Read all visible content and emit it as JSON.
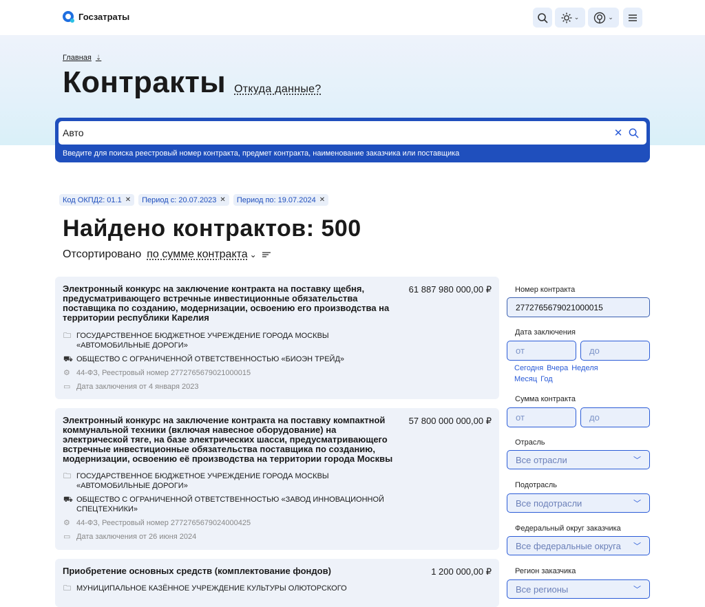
{
  "app": {
    "name": "Госзатраты"
  },
  "breadcrumb": {
    "home": "Главная"
  },
  "page": {
    "title": "Контракты",
    "source_link": "Откуда данные?"
  },
  "search": {
    "value": "Авто",
    "hint": "Введите для поиска реестровый номер контракта, предмет контракта, наименование заказчика или поставщика"
  },
  "filters_chips": [
    {
      "label": "Код ОКПД2: 01.1"
    },
    {
      "label": "Период с: 20.07.2023"
    },
    {
      "label": "Период по: 19.07.2024"
    }
  ],
  "results": {
    "found_label": "Найдено контрактов: 500",
    "sort_prefix": "Отсортировано",
    "sort_value": "по сумме контракта"
  },
  "contracts": [
    {
      "title": "Электронный конкурс на заключение контракта на поставку щебня, предусматривающего встречные инвестиционные обязательства поставщика по созданию, модернизации, освоению его производства на территории республики Карелия",
      "sum": "61 887 980 000,00 ₽",
      "customer": "ГОСУДАРСТВЕННОЕ БЮДЖЕТНОЕ УЧРЕЖДЕНИЕ ГОРОДА МОСКВЫ «АВТОМОБИЛЬНЫЕ ДОРОГИ»",
      "supplier": "ОБЩЕСТВО С ОГРАНИЧЕННОЙ ОТВЕТСТВЕННОСТЬЮ «БИОЭН ТРЕЙД»",
      "registry": "44-ФЗ, Реестровый номер 2772765679021000015",
      "date": "Дата заключения от 4 января 2023"
    },
    {
      "title": "Электронный конкурс на заключение контракта на поставку компактной коммунальной техники (включая навесное оборудование) на электрической тяге, на базе электрических шасси, предусматривающего встречные инвестиционные обязательства поставщика по созданию, модернизации, освоению её производства на территории города Москвы",
      "sum": "57 800 000 000,00 ₽",
      "customer": "ГОСУДАРСТВЕННОЕ БЮДЖЕТНОЕ УЧРЕЖДЕНИЕ ГОРОДА МОСКВЫ «АВТОМОБИЛЬНЫЕ ДОРОГИ»",
      "supplier": "ОБЩЕСТВО С ОГРАНИЧЕННОЙ ОТВЕТСТВЕННОСТЬЮ «ЗАВОД ИННОВАЦИОННОЙ СПЕЦТЕХНИКИ»",
      "registry": "44-ФЗ, Реестровый номер 2772765679024000425",
      "date": "Дата заключения от 26 июня 2024"
    },
    {
      "title": "Приобретение основных средств (комплектование фондов)",
      "sum": "1 200 000,00 ₽",
      "customer": "МУНИЦИПАЛЬНОЕ КАЗЁННОЕ УЧРЕЖДЕНИЕ КУЛЬТУРЫ ОЛЮТОРСКОГО"
    }
  ],
  "sidebar": {
    "contract_number_label": "Номер контракта",
    "contract_number_value": "2772765679021000015",
    "date_label": "Дата заключения",
    "from_placeholder": "от",
    "to_placeholder": "до",
    "quick_dates": [
      "Сегодня",
      "Вчера",
      "Неделя",
      "Месяц",
      "Год"
    ],
    "sum_label": "Сумма контракта",
    "industry_label": "Отрасль",
    "industry_value": "Все отрасли",
    "subindustry_label": "Подотрасль",
    "subindustry_value": "Все подотрасли",
    "district_label": "Федеральный округ заказчика",
    "district_value": "Все федеральные округа",
    "region_label": "Регион заказчика",
    "region_value": "Все регионы"
  }
}
